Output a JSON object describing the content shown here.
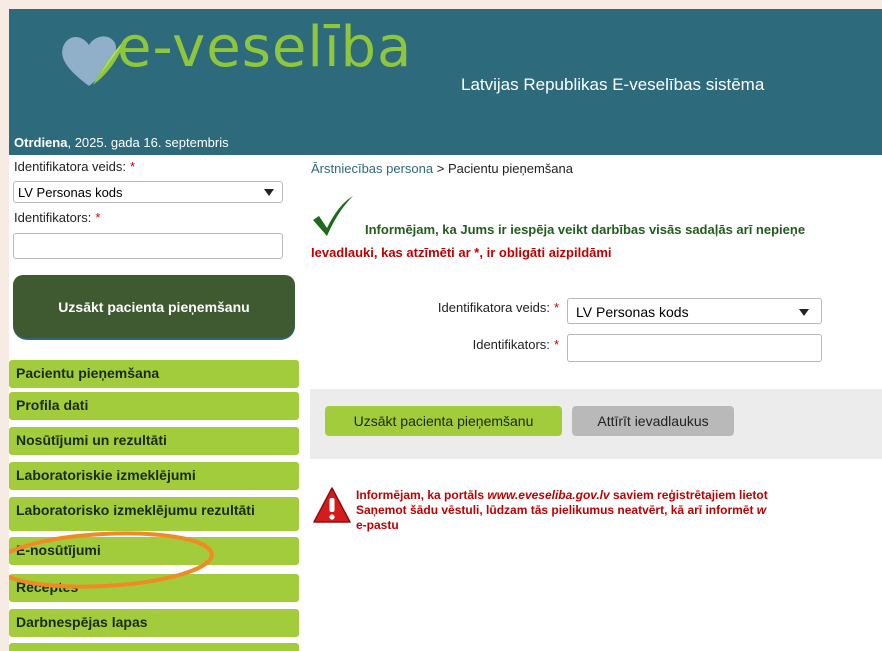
{
  "header": {
    "logo_text": "e-veselība",
    "system_name": "Latvijas Republikas E-veselības sistēma",
    "date_day": "Otrdiena",
    "date_rest": ", 2025. gada 16. septembris",
    "colors": {
      "header_bg": "#2c6a7c",
      "logo_green": "#8fc63c"
    }
  },
  "sidebar": {
    "id_type_label": "Identifikatora veids:",
    "id_type_value": "LV Personas kods",
    "id_label": "Identifikators:",
    "required_mark": "*",
    "start_button": "Uzsākt pacienta pieņemšanu",
    "nav": [
      "Pacientu pieņemšana",
      "Profila dati",
      "Nosūtījumi un rezultāti",
      "Laboratoriskie izmeklējumi",
      "Laboratorisko izmeklējumu rezultāti",
      "E-nosūtījumi",
      "Receptes",
      "Darbnespējas lapas"
    ],
    "colors": {
      "nav_bg": "#a3cc3c",
      "start_bg": "#3f5a31"
    }
  },
  "main": {
    "breadcrumb_link": "Ārstniecības persona",
    "breadcrumb_sep": " > ",
    "breadcrumb_current": "Pacientu pieņemšana",
    "info_message": "Informējam, ka Jums ir iespēja veikt darbības visās sadaļās arī nepieņe",
    "required_note": "Ievadlauki, kas atzīmēti ar *, ir obligāti aizpildāmi",
    "form": {
      "id_type_label": "Identifikatora veids:",
      "id_type_value": "LV Personas kods",
      "id_label": "Identifikators:",
      "required_mark": "*"
    },
    "buttons": {
      "start": "Uzsākt pacienta pieņemšanu",
      "clear": "Attīrīt ievadlaukus"
    },
    "warning": {
      "line1_prefix": "Informējam, ka portāls ",
      "line1_site": "www.eveseliba.gov.lv",
      "line1_suffix": " saviem reģistrētajiem lietot",
      "line2_prefix": "Saņemot šādu vēstuli, lūdzam tās pielikumus neatvērt, kā arī informēt ",
      "line2_italic": "w",
      "line3": "e-pastu"
    },
    "icons": [
      "checkmark-icon",
      "warning-icon",
      "heart-logo-icon",
      "dropdown-caret-icon"
    ],
    "colors": {
      "info_green": "#225c1e",
      "alert_red": "#c00000",
      "highlight_orange": "#f08a24"
    }
  }
}
